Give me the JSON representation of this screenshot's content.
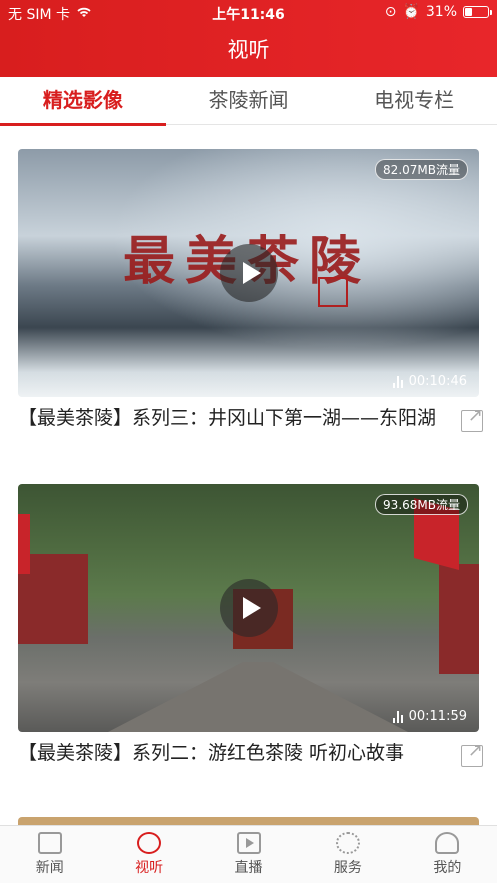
{
  "status_bar": {
    "carrier": "无 SIM 卡",
    "time": "上午11:46",
    "battery": "31%",
    "battery_level": 0.31
  },
  "header": {
    "title": "视听"
  },
  "tabs": [
    {
      "label": "精选影像",
      "active": true
    },
    {
      "label": "茶陵新闻",
      "active": false
    },
    {
      "label": "电视专栏",
      "active": false
    }
  ],
  "videos": [
    {
      "thumbnail_text": "最美茶陵",
      "data_usage": "82.07MB流量",
      "duration": "00:10:46",
      "title": "【最美茶陵】系列三：井冈山下第一湖——东阳湖"
    },
    {
      "data_usage": "93.68MB流量",
      "duration": "00:11:59",
      "title": "【最美茶陵】系列二：游红色茶陵 听初心故事"
    }
  ],
  "bottom_nav": [
    {
      "label": "新闻",
      "icon": "news-icon",
      "active": false
    },
    {
      "label": "视听",
      "icon": "planet-icon",
      "active": true
    },
    {
      "label": "直播",
      "icon": "live-icon",
      "active": false
    },
    {
      "label": "服务",
      "icon": "service-icon",
      "active": false
    },
    {
      "label": "我的",
      "icon": "profile-icon",
      "active": false
    }
  ],
  "colors": {
    "brand": "#d81e1e"
  }
}
